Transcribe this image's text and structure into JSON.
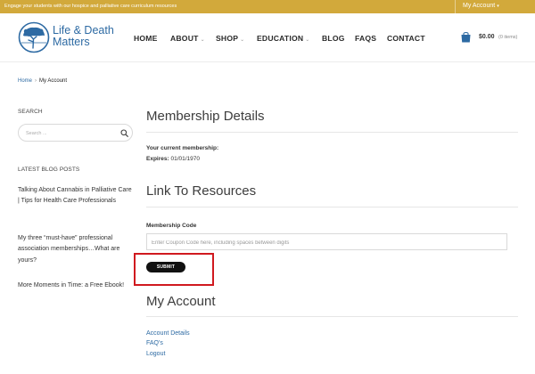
{
  "colors": {
    "topbar_bg": "#d2a93b",
    "brand_blue": "#2d6aa3",
    "highlight_red": "#d0191f",
    "submit_bg": "#111111"
  },
  "topbar": {
    "promo": "Engage your students with our hospice and palliative care curriculum resources",
    "account_label": "My Account",
    "account_caret": "▾"
  },
  "logo": {
    "line1": "Life & Death",
    "line2": "Matters",
    "icon": "tree-in-circle-icon"
  },
  "nav": {
    "items": [
      {
        "label": "HOME",
        "has_dropdown": false
      },
      {
        "label": "ABOUT",
        "has_dropdown": true
      },
      {
        "label": "SHOP",
        "has_dropdown": true
      },
      {
        "label": "EDUCATION",
        "has_dropdown": true
      },
      {
        "label": "BLOG",
        "has_dropdown": false
      },
      {
        "label": "FAQS",
        "has_dropdown": false
      },
      {
        "label": "CONTACT",
        "has_dropdown": false
      }
    ],
    "chevron": "⌄"
  },
  "cart": {
    "icon": "shopping-bag-icon",
    "total": "$0.00",
    "items": "(0 items)"
  },
  "breadcrumb": {
    "home": "Home",
    "separator": "›",
    "current": "My Account"
  },
  "sidebar": {
    "search_heading": "SEARCH",
    "search_placeholder": "Search ...",
    "search_icon": "magnifier-icon",
    "posts_heading": "LATEST BLOG POSTS",
    "posts": [
      {
        "title": "Talking About Cannabis in Palliative Care | Tips for Health Care Professionals"
      },
      {
        "title": "My three “must-have” professional association memberships…What are yours?"
      },
      {
        "title": "More Moments in Time: a Free Ebook!"
      }
    ]
  },
  "membership": {
    "heading": "Membership Details",
    "current_label": "Your current membership:",
    "expires_label": "Expires:",
    "expires_value": "01/01/1970"
  },
  "resources": {
    "heading": "Link To Resources",
    "code_label": "Membership Code",
    "code_placeholder": "Enter Coupon Code here, including spaces between digits",
    "code_value": "",
    "submit_label": "SUBMIT"
  },
  "account": {
    "heading": "My Account",
    "links": [
      {
        "label": "Account Details"
      },
      {
        "label": "FAQ's"
      },
      {
        "label": "Logout"
      }
    ]
  }
}
